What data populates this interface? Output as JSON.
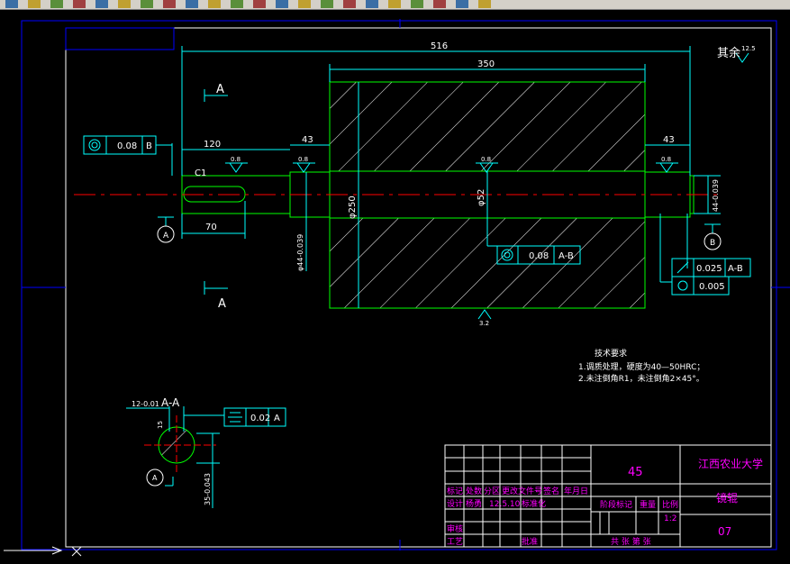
{
  "toolbar": {
    "buttons": [
      "open-icon",
      "save-icon",
      "print-icon",
      "preview-icon",
      "publish-icon",
      "pan-icon",
      "zoom-icon",
      "undo-icon",
      "redo-icon",
      "match-icon",
      "zoom-realtime-icon",
      "zoom-window-icon",
      "zoom-previous-icon",
      "properties-icon",
      "design-center-icon",
      "tool-palette-icon",
      "sheet-set-icon",
      "markup-icon",
      "calculator-icon",
      "help-icon",
      "layer-icon",
      "layer-state-icon"
    ]
  },
  "drawing": {
    "dims": {
      "overall": "516",
      "body": "350",
      "left_step": "120",
      "left_gap": "43",
      "right_gap": "43",
      "keyway": "70",
      "chamfer": "C1",
      "body_dia": "φ250",
      "bore_dia": "φ52",
      "left_shaft_dia": "φ44-0.039",
      "right_shaft_dia": "44-0.039",
      "roughness_general": "0.8",
      "roughness_bottom": "3.2",
      "roughness_other": "12.5"
    },
    "section_label_top": "A",
    "section_label_bottom": "A",
    "datum_a": "A",
    "datum_b": "B",
    "remaining_note": "其余",
    "tolerances": {
      "left": {
        "value": "0.08",
        "datum": "B"
      },
      "center": {
        "value": "0.08",
        "datum": "A-B"
      },
      "runout": {
        "value": "0.025",
        "datum": "A-B"
      },
      "cyl": {
        "value": "0.005"
      }
    },
    "section_view": {
      "title": "A-A",
      "key_width": "12-0.01",
      "key_depth_label": "15",
      "depth": "35-0.043",
      "symmetry": {
        "value": "0.02",
        "datum": "A"
      },
      "datum": "A"
    },
    "notes": {
      "title": "技术要求",
      "line1": "1.调质处理，硬度为40—50HRC；",
      "line2": "2.未注倒角R1，未注倒角2×45°。"
    }
  },
  "title_block": {
    "material": "45",
    "school": "江西农业大学",
    "part_name": "镜辊",
    "drawing_no": "07",
    "scale_label": "比例",
    "scale": "1:2",
    "weight_label": "重量",
    "stage_label": "阶段标记",
    "sheets": "共  张 第  张",
    "rows": {
      "r1": [
        "标记",
        "处数",
        "分区",
        "更改文件号",
        "签名",
        "年月日"
      ],
      "r2": [
        "设计",
        "杨勇",
        "12.5.10",
        "标准化"
      ],
      "r3": [
        "审核"
      ],
      "r4": [
        "工艺",
        "",
        "",
        "批准"
      ]
    }
  },
  "colors": {
    "outline": "#00ff00",
    "dimension": "#00ffff",
    "border": "#0000ff",
    "centerline": "#ff0000",
    "text_white": "#ffffff",
    "title_magenta": "#ff00ff"
  }
}
